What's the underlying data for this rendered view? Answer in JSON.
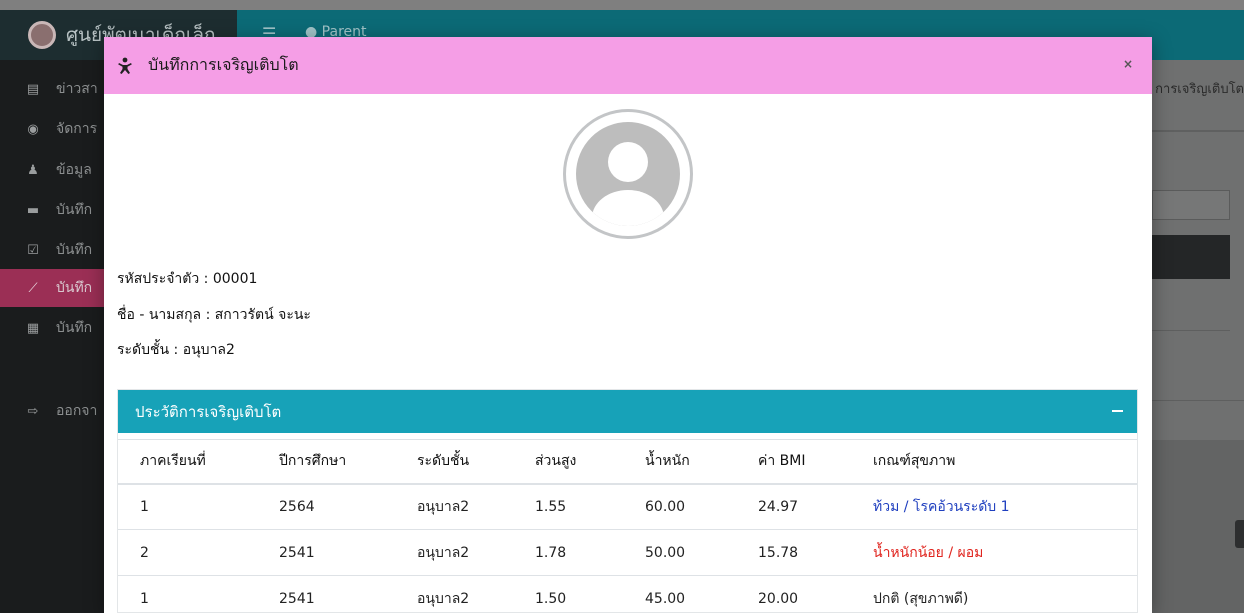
{
  "app": {
    "brand": "ศูนย์พัฒนาเด็กเล็ก",
    "top_user": "Parent",
    "breadcrumb": "การเจริญเติบโต"
  },
  "sidebar": {
    "items": [
      {
        "label": "ข่าวสา",
        "icon": "newspaper-icon"
      },
      {
        "label": "จัดการ",
        "icon": "user-circle-icon"
      },
      {
        "label": "ข้อมูล",
        "icon": "child-icon"
      },
      {
        "label": "บันทึก",
        "icon": "calendar-icon"
      },
      {
        "label": "บันทึก",
        "icon": "calendar-check-icon"
      },
      {
        "label": "บันทึก",
        "icon": "chart-line-icon"
      },
      {
        "label": "บันทึก",
        "icon": "clipboard-icon"
      },
      {
        "label": "ออกจา",
        "icon": "sign-out-icon"
      }
    ],
    "active_index": 5
  },
  "modal": {
    "title": "บันทึกการเจริญเติบโต",
    "close_label": "×",
    "student": {
      "id_line": "รหัสประจำตัว : 00001",
      "name_line": "ชื่อ - นามสกุล : สกาวรัตน์ จะนะ",
      "level_line": "ระดับชั้น : อนุบาล2"
    },
    "history": {
      "title": "ประวัติการเจริญเติบโต",
      "columns": [
        "ภาคเรียนที่",
        "ปีการศึกษา",
        "ระดับชั้น",
        "ส่วนสูง",
        "น้ำหนัก",
        "ค่า BMI",
        "เกณฑ์สุขภาพ"
      ],
      "rows": [
        {
          "term": "1",
          "year": "2564",
          "level": "อนุบาล2",
          "height": "1.55",
          "weight": "60.00",
          "bmi": "24.97",
          "status": "ท้วม / โรคอ้วนระดับ 1",
          "status_color": "#1f3fbf"
        },
        {
          "term": "2",
          "year": "2541",
          "level": "อนุบาล2",
          "height": "1.78",
          "weight": "50.00",
          "bmi": "15.78",
          "status": "น้ำหนักน้อย / ผอม",
          "status_color": "#e0241e"
        },
        {
          "term": "1",
          "year": "2541",
          "level": "อนุบาล2",
          "height": "1.50",
          "weight": "45.00",
          "bmi": "20.00",
          "status": "ปกติ (สุขภาพดี)",
          "status_color": "#222222"
        }
      ]
    }
  },
  "colors": {
    "modal_header": "#f59ee6",
    "card_header": "#17a2b8",
    "topbar": "#0c6a76",
    "sidebar_active": "#9b2f55"
  }
}
